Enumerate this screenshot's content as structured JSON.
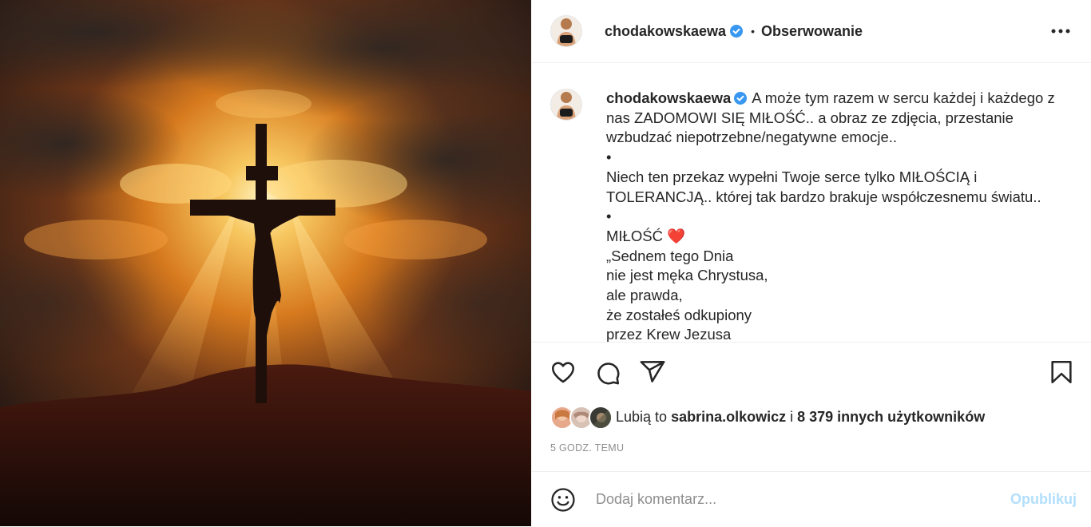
{
  "post": {
    "username": "chodakowskaewa",
    "follow_dot": "•",
    "follow_label": "Obserwowanie",
    "caption": {
      "username": "chodakowskaewa",
      "lines": [
        "A może tym razem w sercu każdej i każdego z",
        "nas ZADOMOWI SIĘ MIŁOŚĆ.. a obraz ze zdjęcia, przestanie",
        "wzbudzać niepotrzebne/negatywne emocje..",
        "•",
        "Niech ten przekaz wypełni Twoje serce tylko MIŁOŚCIĄ i",
        "TOLERANCJĄ.. której tak bardzo brakuje współczesnemu światu..",
        "•",
        "MIŁOŚĆ",
        "„Sednem tego Dnia",
        "nie jest męka Chrystusa,",
        "ale prawda,",
        "że zostałeś odkupiony",
        "przez Krew Jezusa"
      ],
      "heart_emoji": "❤️"
    },
    "likes": {
      "prefix": "Lubią to ",
      "user": "sabrina.olkowicz",
      "middle": " i ",
      "others": "8 379 innych użytkowników"
    },
    "time": "5 GODZ. TEMU",
    "comment_placeholder": "Dodaj komentarz...",
    "publish_label": "Opublikuj"
  },
  "icons": {
    "like": "heart-outline-icon",
    "comment": "comment-bubble-icon",
    "share": "paper-plane-icon",
    "save": "bookmark-icon",
    "more": "more-horizontal-icon",
    "emoji": "smiley-icon",
    "verified": "verified-badge-icon"
  },
  "colors": {
    "verified": "#3897f0",
    "publish_disabled": "#b2dffc",
    "heart": "#e0222f"
  }
}
